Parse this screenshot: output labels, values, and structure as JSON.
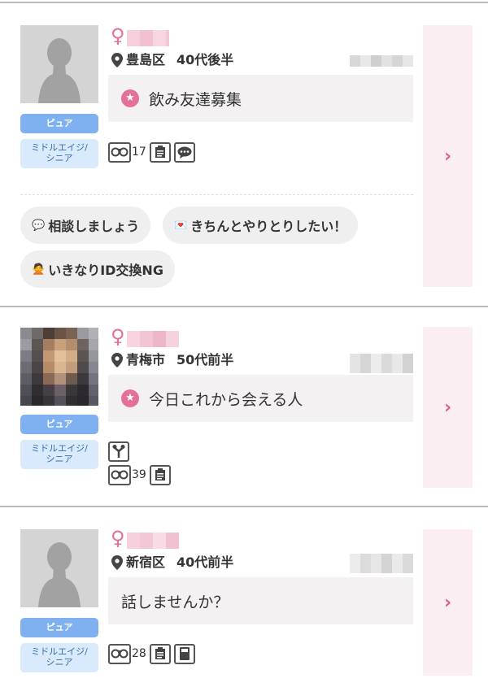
{
  "cards": [
    {
      "gender_symbol": "♀",
      "badge_pure": "ピュア",
      "badge_age": "ミドルエイジ/\nシニア",
      "location": "豊島区",
      "age": "40代後半",
      "message": "飲み友達募集",
      "footprints": "17",
      "tags": [
        "相談しましょう",
        "きちんとやりとりしたい！",
        "いきなりID交換NG"
      ],
      "arrow": "›"
    },
    {
      "gender_symbol": "♀",
      "badge_pure": "ピュア",
      "badge_age": "ミドルエイジ/\nシニア",
      "location": "青梅市",
      "age": "50代前半",
      "message": "今日これから会える人",
      "footprints": "39",
      "arrow": "›"
    },
    {
      "gender_symbol": "♀",
      "badge_pure": "ピュア",
      "badge_age": "ミドルエイジ/\nシニア",
      "location": "新宿区",
      "age": "40代前半",
      "message": "話しませんか？",
      "footprints": "28",
      "arrow": "›"
    }
  ],
  "colors": {
    "accent": "#e2709b",
    "badge_blue": "#7fb0f0",
    "badge_light": "#d8eafc",
    "panel_pink": "#fbeef2"
  },
  "icons": [
    "female-icon",
    "location-pin-icon",
    "star-icon",
    "glasses-icon",
    "memo-icon",
    "chat-icon",
    "antenna-icon",
    "calculator-icon",
    "chevron-right-icon"
  ]
}
